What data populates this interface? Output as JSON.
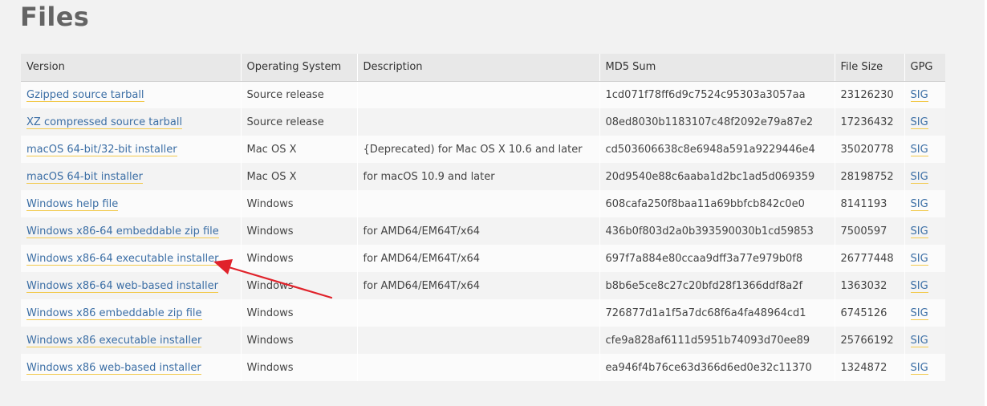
{
  "page": {
    "title": "Files"
  },
  "table": {
    "headers": {
      "version": "Version",
      "os": "Operating System",
      "description": "Description",
      "md5": "MD5 Sum",
      "size": "File Size",
      "gpg": "GPG"
    },
    "rows": [
      {
        "version": "Gzipped source tarball",
        "os": "Source release",
        "description": "",
        "md5": "1cd071f78ff6d9c7524c95303a3057aa",
        "size": "23126230",
        "gpg": "SIG"
      },
      {
        "version": "XZ compressed source tarball",
        "os": "Source release",
        "description": "",
        "md5": "08ed8030b1183107c48f2092e79a87e2",
        "size": "17236432",
        "gpg": "SIG"
      },
      {
        "version": "macOS 64-bit/32-bit installer",
        "os": "Mac OS X",
        "description": "{Deprecated) for Mac OS X 10.6 and later",
        "md5": "cd503606638c8e6948a591a9229446e4",
        "size": "35020778",
        "gpg": "SIG"
      },
      {
        "version": "macOS 64-bit installer",
        "os": "Mac OS X",
        "description": "for macOS 10.9 and later",
        "md5": "20d9540e88c6aaba1d2bc1ad5d069359",
        "size": "28198752",
        "gpg": "SIG"
      },
      {
        "version": "Windows help file",
        "os": "Windows",
        "description": "",
        "md5": "608cafa250f8baa11a69bbfcb842c0e0",
        "size": "8141193",
        "gpg": "SIG"
      },
      {
        "version": "Windows x86-64 embeddable zip file",
        "os": "Windows",
        "description": "for AMD64/EM64T/x64",
        "md5": "436b0f803d2a0b393590030b1cd59853",
        "size": "7500597",
        "gpg": "SIG"
      },
      {
        "version": "Windows x86-64 executable installer",
        "os": "Windows",
        "description": "for AMD64/EM64T/x64",
        "md5": "697f7a884e80ccaa9dff3a77e979b0f8",
        "size": "26777448",
        "gpg": "SIG"
      },
      {
        "version": "Windows x86-64 web-based installer",
        "os": "Windows",
        "description": "for AMD64/EM64T/x64",
        "md5": "b8b6e5ce8c27c20bfd28f1366ddf8a2f",
        "size": "1363032",
        "gpg": "SIG"
      },
      {
        "version": "Windows x86 embeddable zip file",
        "os": "Windows",
        "description": "",
        "md5": "726877d1a1f5a7dc68f6a4fa48964cd1",
        "size": "6745126",
        "gpg": "SIG"
      },
      {
        "version": "Windows x86 executable installer",
        "os": "Windows",
        "description": "",
        "md5": "cfe9a828af6111d5951b74093d70ee89",
        "size": "25766192",
        "gpg": "SIG"
      },
      {
        "version": "Windows x86 web-based installer",
        "os": "Windows",
        "description": "",
        "md5": "ea946f4b76ce63d366d6ed0e32c11370",
        "size": "1324872",
        "gpg": "SIG"
      }
    ]
  },
  "annotation": {
    "arrow_color": "#e0222a"
  }
}
